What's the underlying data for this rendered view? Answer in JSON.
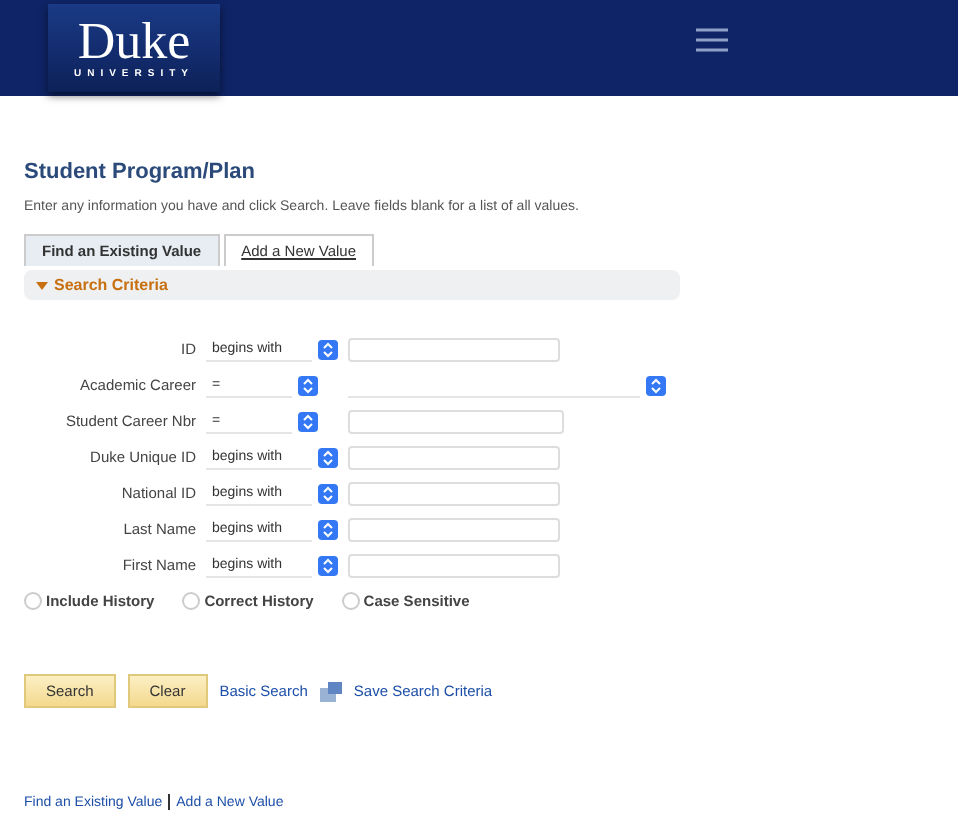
{
  "header": {
    "logo": {
      "name": "Duke",
      "subtitle": "UNIVERSITY"
    }
  },
  "page": {
    "title": "Student Program/Plan",
    "instructions": "Enter any information you have and click Search. Leave fields blank for a list of all values."
  },
  "tabs": [
    {
      "label": "Find an Existing Value",
      "selected": true
    },
    {
      "label": "Add a New Value",
      "selected": false
    }
  ],
  "search_criteria": {
    "title": "Search Criteria",
    "expanded": true,
    "fields": [
      {
        "label": "ID",
        "operator": "begins with",
        "kind": "text"
      },
      {
        "label": "Academic Career",
        "operator": "=",
        "kind": "select"
      },
      {
        "label": "Student Career Nbr",
        "operator": "=",
        "kind": "short"
      },
      {
        "label": "Duke Unique ID",
        "operator": "begins with",
        "kind": "text"
      },
      {
        "label": "National ID",
        "operator": "begins with",
        "kind": "text"
      },
      {
        "label": "Last Name",
        "operator": "begins with",
        "kind": "text"
      },
      {
        "label": "First Name",
        "operator": "begins with",
        "kind": "text"
      }
    ],
    "options": [
      {
        "label": "Include History",
        "checked": false
      },
      {
        "label": "Correct History",
        "checked": false
      },
      {
        "label": "Case Sensitive",
        "checked": false
      }
    ]
  },
  "actions": {
    "buttons": [
      "Search",
      "Clear"
    ],
    "links": [
      "Basic Search",
      "Save Search Criteria"
    ]
  },
  "footer_links": [
    "Find an Existing Value",
    "Add a New Value"
  ]
}
